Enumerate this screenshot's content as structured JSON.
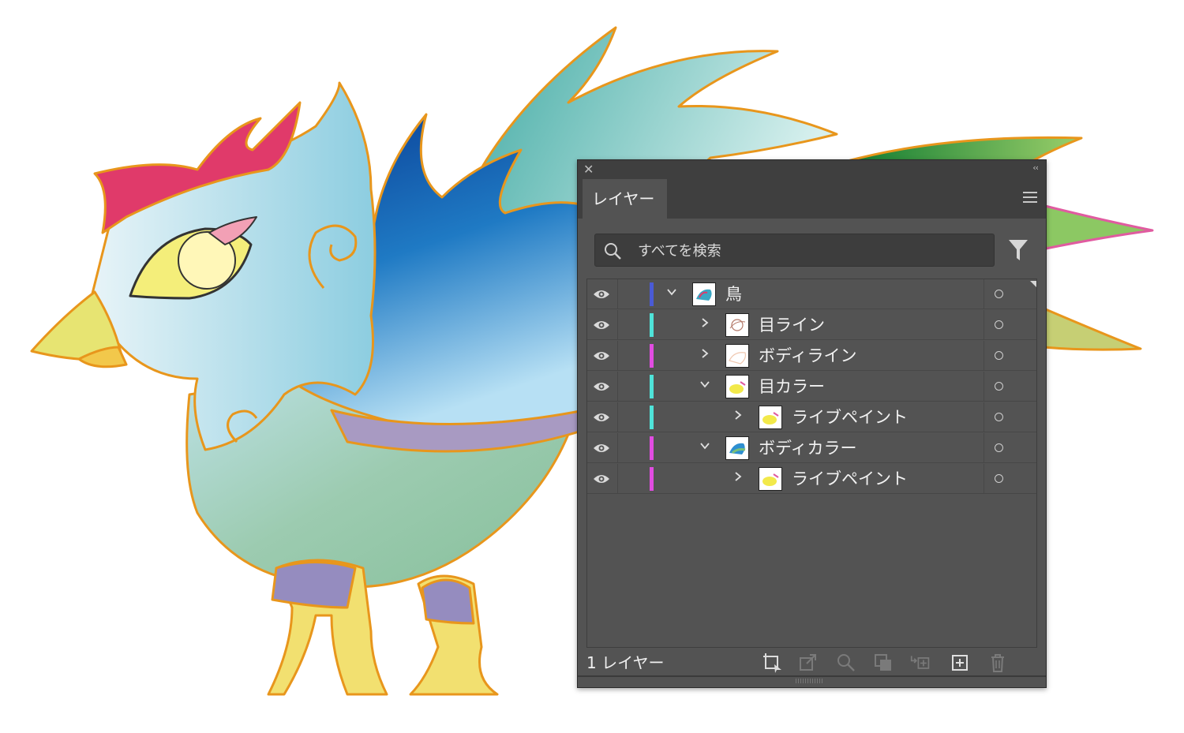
{
  "panel": {
    "tab_label": "レイヤー",
    "search_placeholder": "すべてを検索",
    "layer_count": "1 レイヤー"
  },
  "layers": [
    {
      "name": "鳥",
      "expanded": true,
      "color": "#4a5bd6",
      "indent": 0,
      "icon": "bird-thumbnail"
    },
    {
      "name": "目ライン",
      "expanded": false,
      "color": "#4fe3d9",
      "indent": 1,
      "icon": "eye-line-thumbnail"
    },
    {
      "name": "ボディライン",
      "expanded": false,
      "color": "#e14ce1",
      "indent": 1,
      "icon": "body-line-thumbnail"
    },
    {
      "name": "目カラー",
      "expanded": true,
      "color": "#4fe3d9",
      "indent": 1,
      "icon": "eye-color-thumbnail"
    },
    {
      "name": "ライブペイント",
      "expanded": false,
      "color": "#4fe3d9",
      "indent": 2,
      "icon": "live-paint-thumbnail"
    },
    {
      "name": "ボディカラー",
      "expanded": true,
      "color": "#e14ce1",
      "indent": 1,
      "icon": "body-color-thumbnail"
    },
    {
      "name": "ライブペイント",
      "expanded": false,
      "color": "#e14ce1",
      "indent": 2,
      "icon": "live-paint-thumbnail"
    }
  ],
  "footer_icons": [
    "collect-for-export-icon",
    "export-icon",
    "locate-object-icon",
    "make-clipping-mask-icon",
    "create-sublayer-icon",
    "new-layer-icon",
    "delete-icon"
  ],
  "colors": {
    "panel_bg": "#535353",
    "panel_dark": "#3f3f3f",
    "artwork_outline": "#e8961c"
  }
}
